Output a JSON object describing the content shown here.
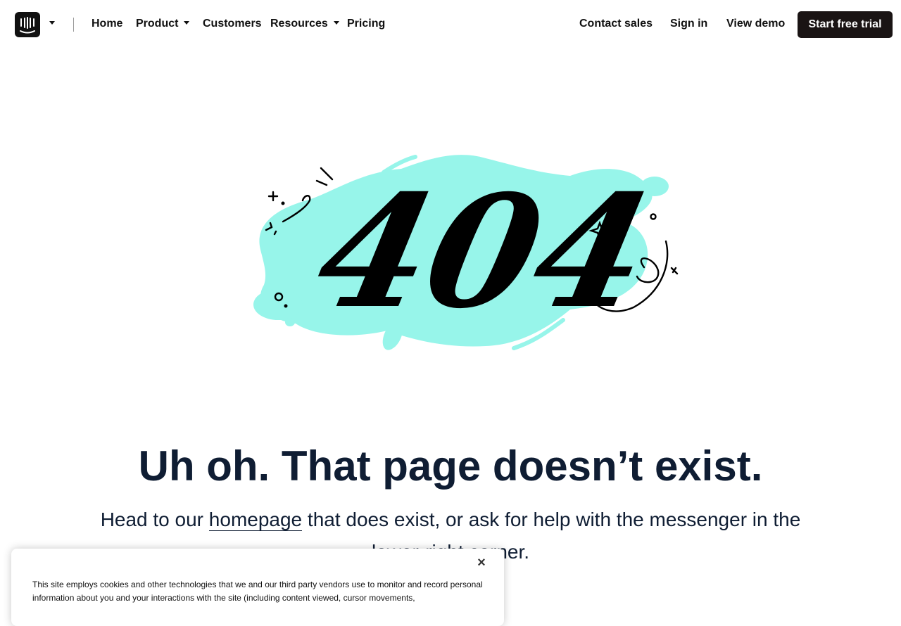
{
  "nav": {
    "links": [
      "Home",
      "Product",
      "Customers",
      "Resources",
      "Pricing"
    ],
    "right": [
      "Contact sales",
      "Sign in",
      "View demo"
    ],
    "cta": "Start free trial"
  },
  "hero": {
    "error_code": "404",
    "headline": "Uh oh. That page doesn’t exist.",
    "sub_before": "Head to our ",
    "sub_link": "homepage",
    "sub_after": " that does exist, or ask for help with the messenger in the lower-right corner."
  },
  "cookie": {
    "text": "This site employs cookies and other technologies that we and our third party vendors use to monitor and record personal information about you and your interactions with the site (including content viewed, cursor movements,",
    "close_label": "×"
  },
  "colors": {
    "accent_blob": "#97f5ea",
    "cta_bg": "#1a1414",
    "headline": "#0f1d33"
  },
  "icons": [
    "intercom-logo-icon",
    "chevron-down-icon",
    "close-icon"
  ]
}
